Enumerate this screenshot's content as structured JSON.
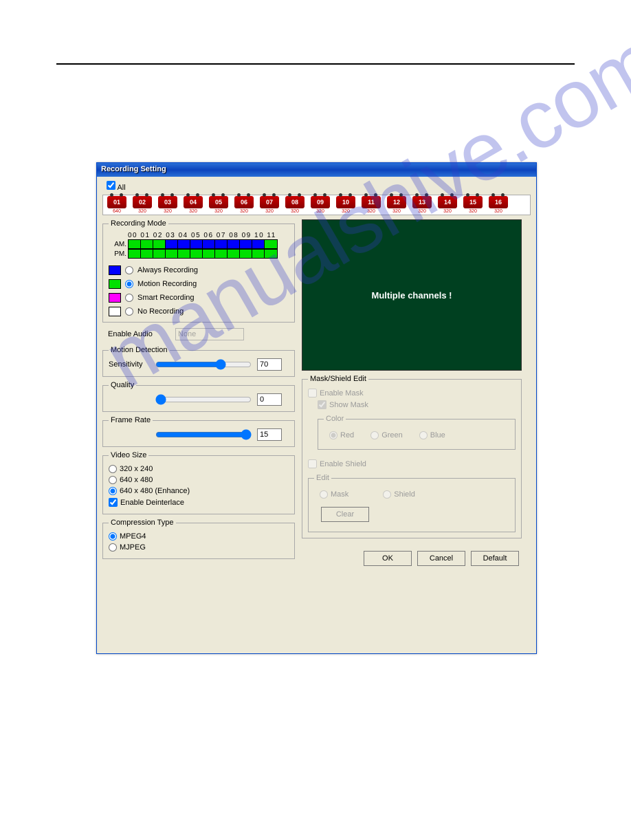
{
  "window": {
    "title": "Recording Setting"
  },
  "all_checkbox": {
    "label": "All",
    "checked": true
  },
  "cameras": [
    {
      "num": "01",
      "res": "640"
    },
    {
      "num": "02",
      "res": "320"
    },
    {
      "num": "03",
      "res": "320"
    },
    {
      "num": "04",
      "res": "320"
    },
    {
      "num": "05",
      "res": "320"
    },
    {
      "num": "06",
      "res": "320"
    },
    {
      "num": "07",
      "res": "320"
    },
    {
      "num": "08",
      "res": "320"
    },
    {
      "num": "09",
      "res": "320"
    },
    {
      "num": "10",
      "res": "320"
    },
    {
      "num": "11",
      "res": "320"
    },
    {
      "num": "12",
      "res": "320"
    },
    {
      "num": "13",
      "res": "320"
    },
    {
      "num": "14",
      "res": "320"
    },
    {
      "num": "15",
      "res": "320"
    },
    {
      "num": "16",
      "res": "320"
    }
  ],
  "recording_mode": {
    "legend": "Recording Mode",
    "hours": "00 01 02 03 04 05 06 07 08 09 10 11",
    "am_label": "AM.",
    "pm_label": "PM.",
    "am_cells": [
      "green",
      "green",
      "green",
      "blue",
      "blue",
      "blue",
      "blue",
      "blue",
      "blue",
      "blue",
      "blue",
      "green"
    ],
    "pm_cells": [
      "green",
      "green",
      "green",
      "green",
      "green",
      "green",
      "green",
      "green",
      "green",
      "green",
      "green",
      "green"
    ],
    "options": [
      {
        "color": "#0000ff",
        "label": "Always Recording",
        "selected": false
      },
      {
        "color": "#00e000",
        "label": "Motion Recording",
        "selected": true
      },
      {
        "color": "#ff00ff",
        "label": "Smart Recording",
        "selected": false
      },
      {
        "color": "#ffffff",
        "label": "No Recording",
        "selected": false
      }
    ]
  },
  "enable_audio": {
    "label": "Enable Audio",
    "value": "None"
  },
  "motion_detection": {
    "legend": "Motion Detection",
    "sensitivity_label": "Sensitivity",
    "value": "70"
  },
  "quality": {
    "legend": "Quality",
    "value": "0"
  },
  "frame_rate": {
    "legend": "Frame Rate",
    "value": "15"
  },
  "video_size": {
    "legend": "Video Size",
    "options": [
      "320 x 240",
      "640 x 480",
      "640 x 480 (Enhance)"
    ],
    "selected": 2,
    "deinterlace_label": "Enable Deinterlace",
    "deinterlace_checked": true
  },
  "compression": {
    "legend": "Compression Type",
    "options": [
      "MPEG4",
      "MJPEG"
    ],
    "selected": 0
  },
  "preview": {
    "text": "Multiple channels !"
  },
  "mask_shield": {
    "legend": "Mask/Shield Edit",
    "enable_mask": "Enable Mask",
    "show_mask": "Show Mask",
    "show_mask_checked": true,
    "color_legend": "Color",
    "colors": [
      "Red",
      "Green",
      "Blue"
    ],
    "color_selected": 0,
    "enable_shield": "Enable Shield",
    "edit_legend": "Edit",
    "edit_options": [
      "Mask",
      "Shield"
    ],
    "clear_label": "Clear"
  },
  "buttons": {
    "ok": "OK",
    "cancel": "Cancel",
    "default": "Default"
  }
}
